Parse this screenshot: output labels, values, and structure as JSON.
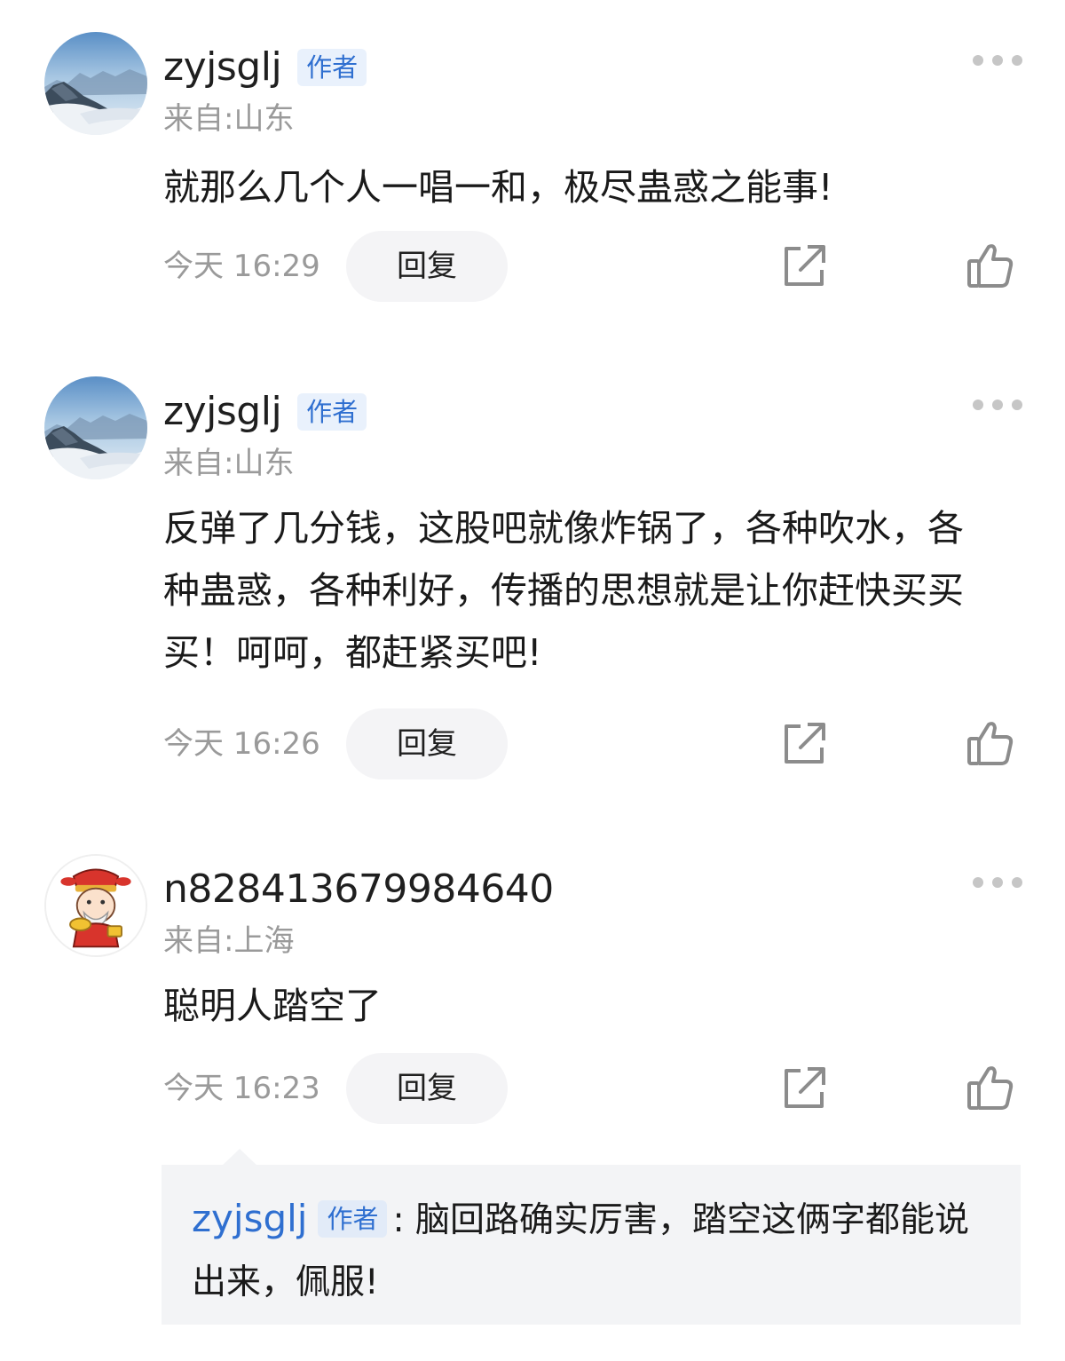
{
  "comments": [
    {
      "username": "zyjsglj",
      "badge": "作者",
      "location": "来自:山东",
      "text": "就那么几个人一唱一和，极尽蛊惑之能事!",
      "time": "今天 16:29",
      "reply_label": "回复",
      "avatar": "mountain-landscape"
    },
    {
      "username": "zyjsglj",
      "badge": "作者",
      "location": "来自:山东",
      "text": "反弹了几分钱，这股吧就像炸锅了，各种吹水，各种蛊惑，各种利好，传播的思想就是让你赶快买买买！呵呵，都赶紧买吧!",
      "time": "今天 16:26",
      "reply_label": "回复",
      "avatar": "mountain-landscape"
    },
    {
      "username": "n828413679984640",
      "location": "来自:上海",
      "text": "聪明人踏空了",
      "time": "今天 16:23",
      "reply_label": "回复",
      "avatar": "god-of-wealth-cartoon",
      "sub_reply": {
        "username": "zyjsglj",
        "badge": "作者",
        "text": ": 脑回路确实厉害，踏空这俩字都能说出来，佩服!"
      }
    }
  ],
  "icons": {
    "more": "more-dots-icon",
    "share": "share-icon",
    "like": "thumbs-up-icon"
  },
  "colors": {
    "badge_text": "#2f6fd0",
    "badge_bg": "#e9f1fc",
    "secondary_text": "#9a9a9a",
    "reply_bg": "#f3f4f6"
  }
}
